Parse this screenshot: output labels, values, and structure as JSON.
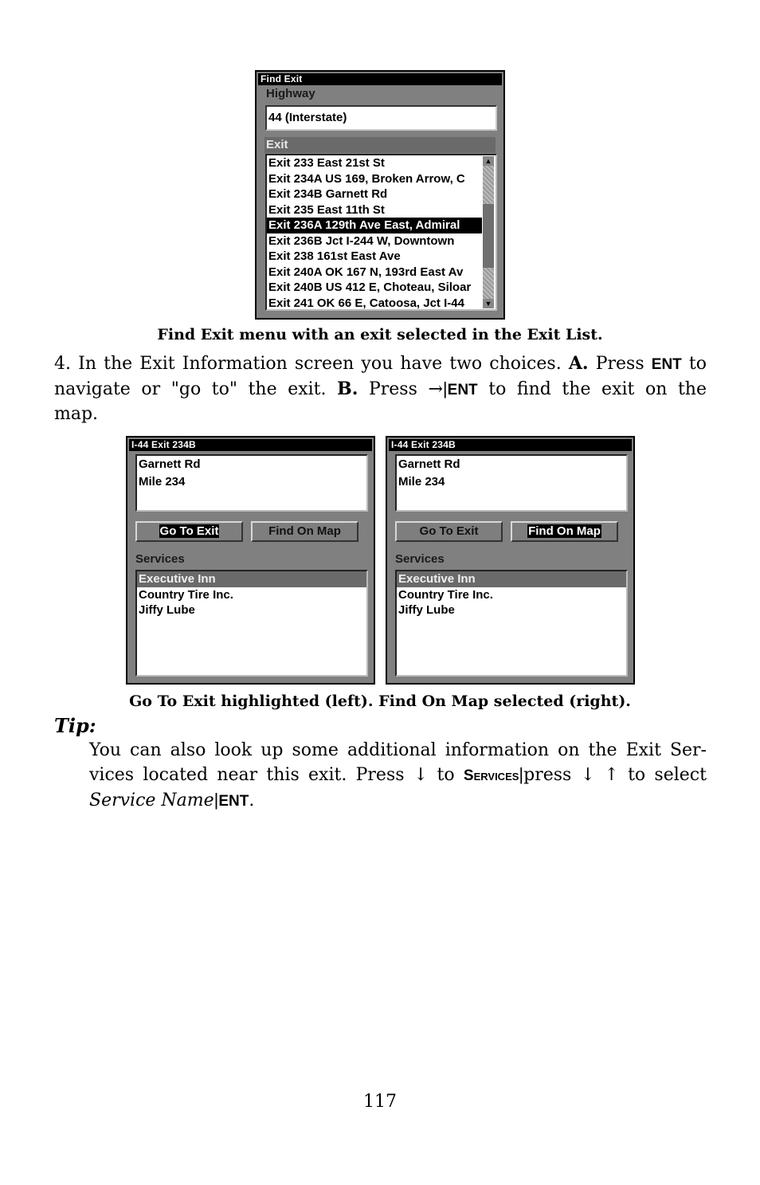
{
  "find_exit_screen": {
    "title": "Find Exit",
    "highway_label": "Highway",
    "highway_value": "44 (Interstate)",
    "exit_label": "Exit",
    "exits": [
      "Exit 233 East 21st St",
      "Exit 234A US 169, Broken Arrow, C",
      "Exit 234B Garnett Rd",
      "Exit 235 East 11th St",
      "Exit 236A 129th Ave East, Admiral",
      "Exit 236B Jct I-244 W, Downtown",
      "Exit 238 161st East Ave",
      "Exit 240A OK 167 N, 193rd East Av",
      "Exit 240B US 412 E, Choteau, Siloar",
      "Exit 241 OK 66 E, Catoosa, Jct I-44"
    ],
    "selected_exit_index": 4,
    "scroll_up_icon": "up-arrow",
    "scroll_down_icon": "down-arrow"
  },
  "caption_1": "Find Exit menu with an exit selected in the Exit List.",
  "step4": {
    "prefix": "4. In the Exit Information screen you have two choices.",
    "a_label": "A.",
    "a_text_1": "Press",
    "key_ent": "ENT",
    "a_text_2": "to navigate or \"go to\" the exit.",
    "b_label": "B.",
    "b_text_1": "Press",
    "arrow_right": "→",
    "separator": "|",
    "b_text_2": "to find the exit on the map."
  },
  "info_screens": [
    {
      "side": "left",
      "title": "I-44 Exit 234B",
      "detail_lines": [
        "Garnett Rd",
        "Mile 234"
      ],
      "go_to_exit_label": "Go To Exit",
      "find_on_map_label": "Find On Map",
      "highlighted": "go_to_exit",
      "services_label": "Services",
      "services": [
        "Executive Inn",
        "Country Tire Inc.",
        "Jiffy Lube"
      ],
      "selected_service_index": 0
    },
    {
      "side": "right",
      "title": "I-44 Exit 234B",
      "detail_lines": [
        "Garnett Rd",
        "Mile 234"
      ],
      "go_to_exit_label": "Go To Exit",
      "find_on_map_label": "Find On Map",
      "highlighted": "find_on_map",
      "services_label": "Services",
      "services": [
        "Executive Inn",
        "Country Tire Inc.",
        "Jiffy Lube"
      ],
      "selected_service_index": 0
    }
  ],
  "caption_2": "Go To Exit highlighted (left). Find On Map selected (right).",
  "tip": {
    "heading": "Tip:",
    "line1": "You can also look up some additional information on the Exit Ser-",
    "line2_a": "vices located near this exit. Press",
    "arrow_down": "↓",
    "line2_b": "to",
    "key_services": "Services",
    "separator": "|",
    "line2_c": "press",
    "arrow_up": "↑",
    "line2_d": "to select",
    "service_name": "Service Name",
    "key_ent": "ENT",
    "period": "."
  },
  "page_number": "117"
}
